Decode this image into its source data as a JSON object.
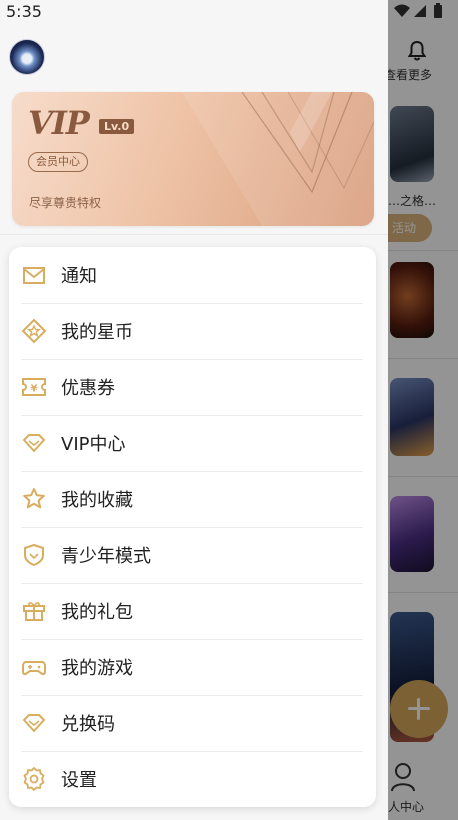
{
  "status_bar": {
    "time": "5:35"
  },
  "drawer": {
    "vip_card": {
      "logo": "VIP",
      "level": "Lv.0",
      "badge": "会员中心",
      "subtitle": "尽享尊贵特权"
    },
    "menu": [
      {
        "label": "通知",
        "icon": "mail-icon"
      },
      {
        "label": "我的星币",
        "icon": "star-coin-icon"
      },
      {
        "label": "优惠券",
        "icon": "coupon-icon"
      },
      {
        "label": "VIP中心",
        "icon": "diamond-icon"
      },
      {
        "label": "我的收藏",
        "icon": "star-icon"
      },
      {
        "label": "青少年模式",
        "icon": "shield-icon"
      },
      {
        "label": "我的礼包",
        "icon": "gift-icon"
      },
      {
        "label": "我的游戏",
        "icon": "gamepad-icon"
      },
      {
        "label": "兑换码",
        "icon": "diamond-code-icon"
      },
      {
        "label": "设置",
        "icon": "gear-icon"
      }
    ]
  },
  "background": {
    "top_label": "查看更多",
    "item_title": "…之格…",
    "pill_label": "活动",
    "bottom_nav_label": "个人中心"
  },
  "colors": {
    "accent": "#d4a85a",
    "icon": "#d9ad5f",
    "vip_text": "#8a5a3e"
  }
}
